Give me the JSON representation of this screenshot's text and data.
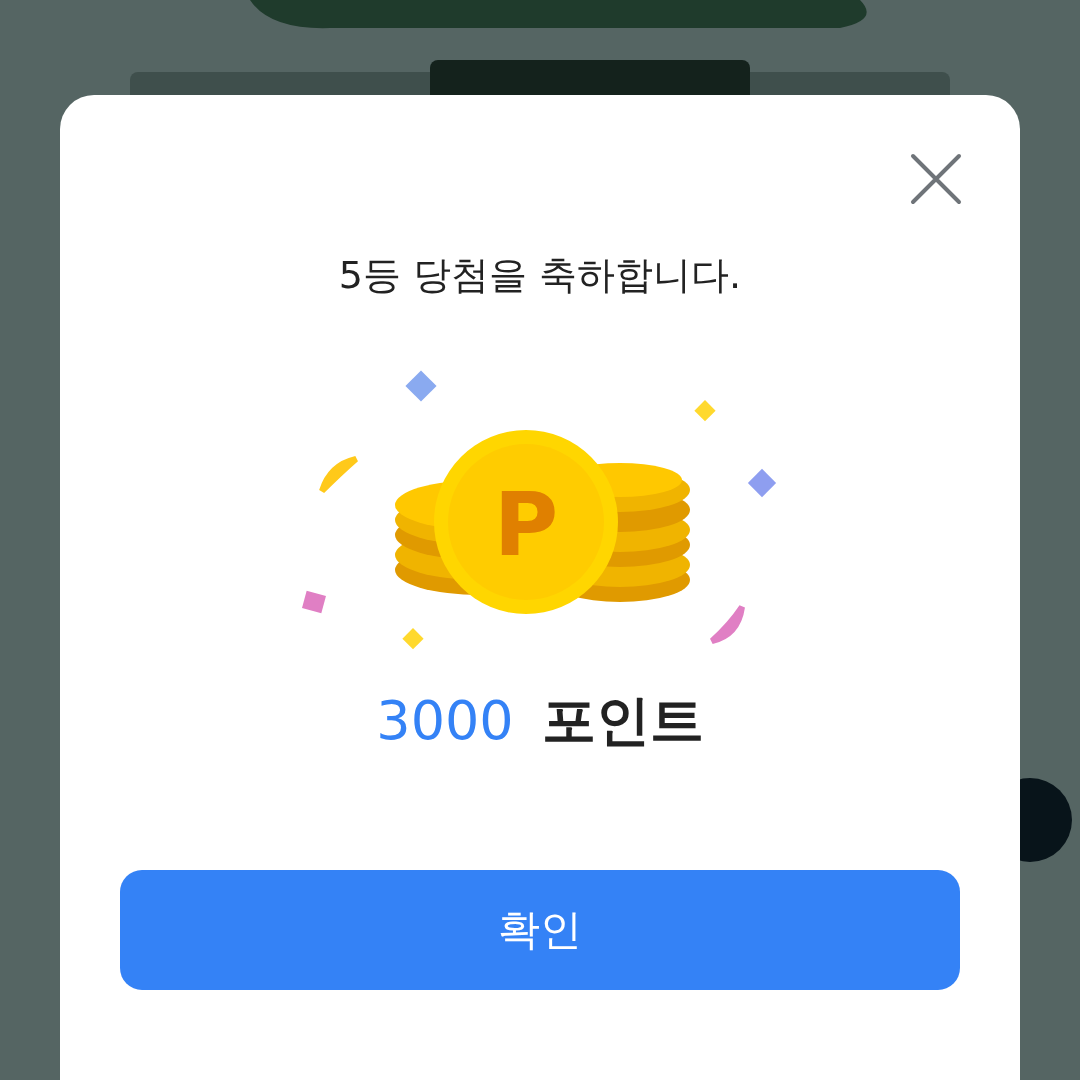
{
  "dialog": {
    "title": "5등 당첨을 축하합니다.",
    "coin_symbol": "P",
    "amount": "3000",
    "unit": "포인트",
    "confirm_button": "확인"
  }
}
